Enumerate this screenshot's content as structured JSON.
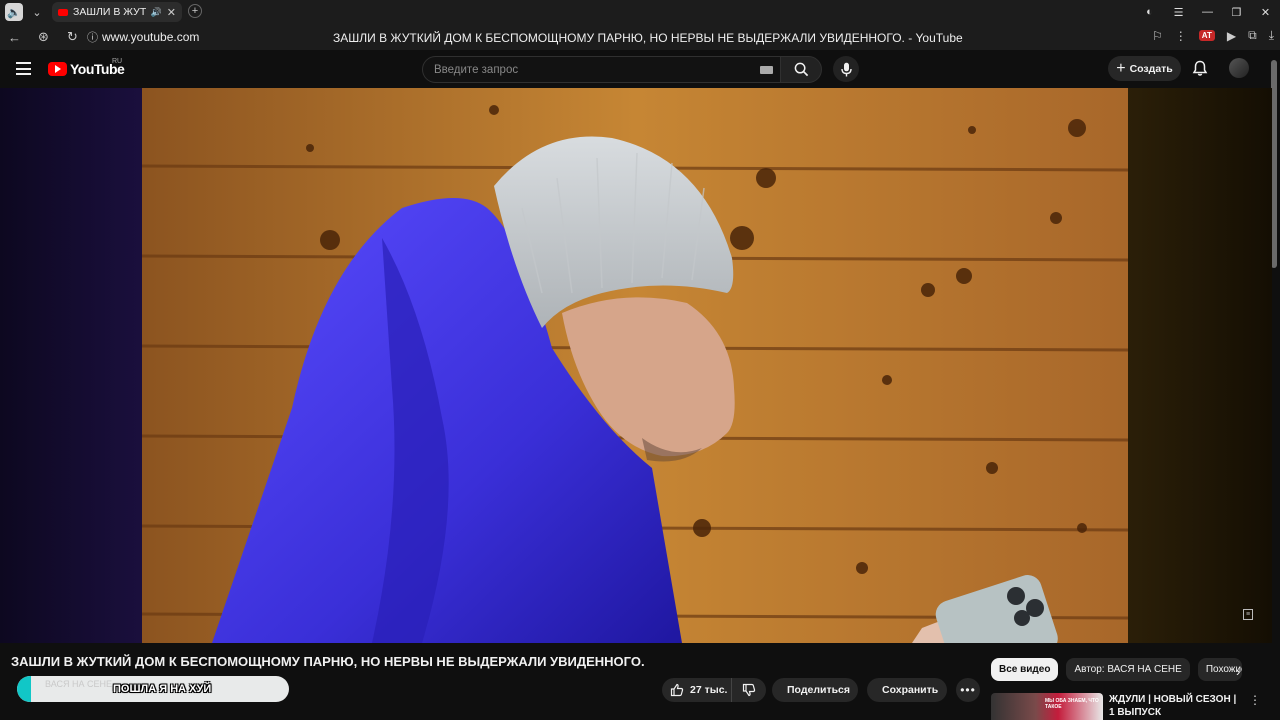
{
  "browser": {
    "tab_title": "ЗАШЛИ В ЖУТКИЙ",
    "url": "www.youtube.com",
    "page_title": "ЗАШЛИ В ЖУТКИЙ ДОМ К БЕСПОМОЩНОМУ ПАРНЮ, НО НЕРВЫ НЕ ВЫДЕРЖАЛИ УВИДЕННОГО. - YouTube",
    "extension_badge": "AT"
  },
  "header": {
    "logo_text": "YouTube",
    "logo_region": "RU",
    "search_placeholder": "Введите запрос",
    "create_label": "Создать"
  },
  "video": {
    "title": "ЗАШЛИ В ЖУТКИЙ ДОМ К БЕСПОМОЩНОМУ ПАРНЮ, НО НЕРВЫ НЕ ВЫДЕРЖАЛИ УВИДЕННОГО.",
    "channel_overlay_text": "ПОШЛА Я НА ХУЙ",
    "channel_ghost_text": "ВАСЯ НА СЕНЕ"
  },
  "actions": {
    "likes": "27 тыс.",
    "share_label": "Поделиться",
    "save_label": "Сохранить"
  },
  "sidebar": {
    "chips": [
      "Все видео",
      "Автор: ВАСЯ НА СЕНЕ",
      "Похожие"
    ],
    "recommendation": {
      "title": "ЖДУЛИ | НОВЫЙ СЕЗОН | 1 ВЫПУСК",
      "thumb_text": "МЫ ОБА ЗНАЕМ, ЧТО ТАКОЕ"
    }
  },
  "colors": {
    "brand": "#ff0000",
    "jacket": "#3a2fd8",
    "wood": "#b5762d"
  }
}
